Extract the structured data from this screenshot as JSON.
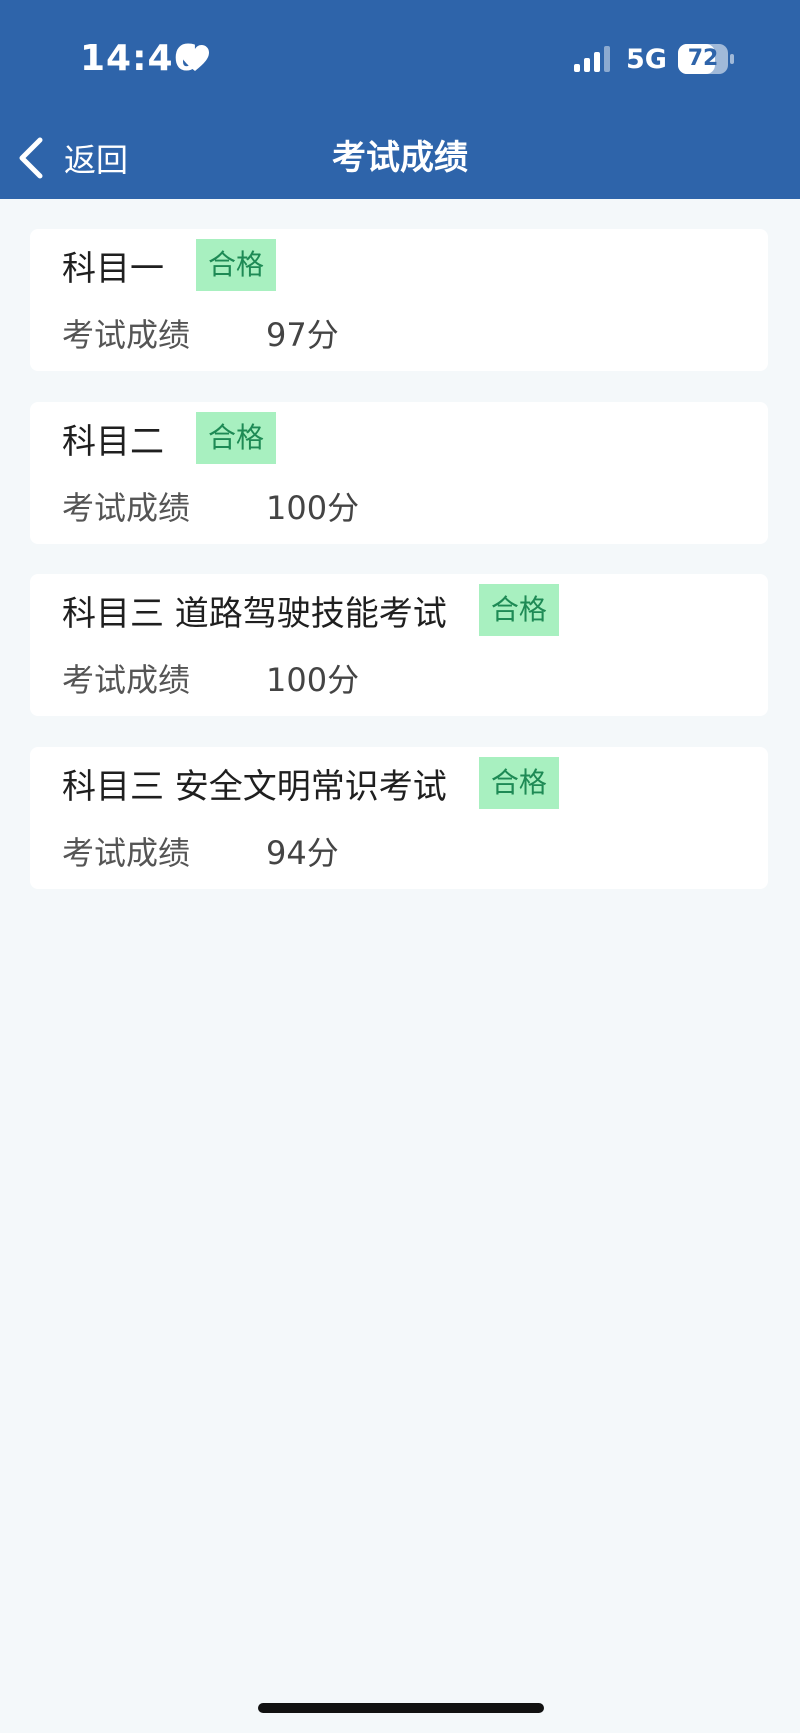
{
  "status_bar": {
    "time": "14:46",
    "network": "5G",
    "battery": "72"
  },
  "nav": {
    "back_label": "返回",
    "title": "考试成绩"
  },
  "results": [
    {
      "subject": "科目一",
      "status": "合格",
      "score_label": "考试成绩",
      "score": "97分"
    },
    {
      "subject": "科目二",
      "status": "合格",
      "score_label": "考试成绩",
      "score": "100分"
    },
    {
      "subject": "科目三 道路驾驶技能考试",
      "status": "合格",
      "score_label": "考试成绩",
      "score": "100分"
    },
    {
      "subject": "科目三 安全文明常识考试",
      "status": "合格",
      "score_label": "考试成绩",
      "score": "94分"
    }
  ],
  "colors": {
    "header": "#2e64aa",
    "badge_bg": "#a8f0c0",
    "badge_text": "#1e8a55",
    "page_bg": "#f4f8fa"
  }
}
